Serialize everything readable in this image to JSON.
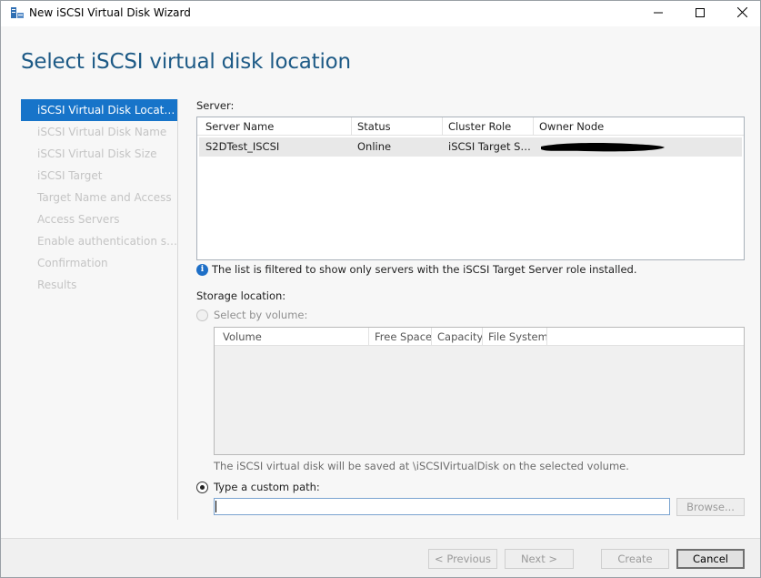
{
  "window": {
    "title": "New iSCSI Virtual Disk Wizard"
  },
  "page_title": "Select iSCSI virtual disk location",
  "nav": {
    "items": [
      {
        "label": "iSCSI Virtual Disk Location",
        "active": true
      },
      {
        "label": "iSCSI Virtual Disk Name",
        "active": false
      },
      {
        "label": "iSCSI Virtual Disk Size",
        "active": false
      },
      {
        "label": "iSCSI Target",
        "active": false
      },
      {
        "label": "Target Name and Access",
        "active": false
      },
      {
        "label": "Access Servers",
        "active": false
      },
      {
        "label": "Enable authentication ser...",
        "active": false
      },
      {
        "label": "Confirmation",
        "active": false
      },
      {
        "label": "Results",
        "active": false
      }
    ]
  },
  "server": {
    "label": "Server:",
    "columns": [
      "Server Name",
      "Status",
      "Cluster Role",
      "Owner Node"
    ],
    "rows": [
      {
        "server_name": "S2DTest_ISCSI",
        "status": "Online",
        "cluster_role": "iSCSI Target Se...",
        "owner_node": "[redacted]"
      }
    ],
    "info_text": "The list is filtered to show only servers with the iSCSI Target Server role installed."
  },
  "storage": {
    "label": "Storage location:",
    "select_by_volume_label": "Select by volume:",
    "volume_columns": [
      "Volume",
      "Free Space",
      "Capacity",
      "File System"
    ],
    "save_note": "The iSCSI virtual disk will be saved at \\iSCSIVirtualDisk on the selected volume.",
    "custom_path_label": "Type a custom path:",
    "custom_path_value": "",
    "browse_label": "Browse..."
  },
  "footer": {
    "previous_label": "< Previous",
    "next_label": "Next >",
    "create_label": "Create",
    "cancel_label": "Cancel"
  },
  "colors": {
    "title_blue": "#1d5a86",
    "nav_active": "#1774c9",
    "info_icon": "#1e6fc7"
  }
}
